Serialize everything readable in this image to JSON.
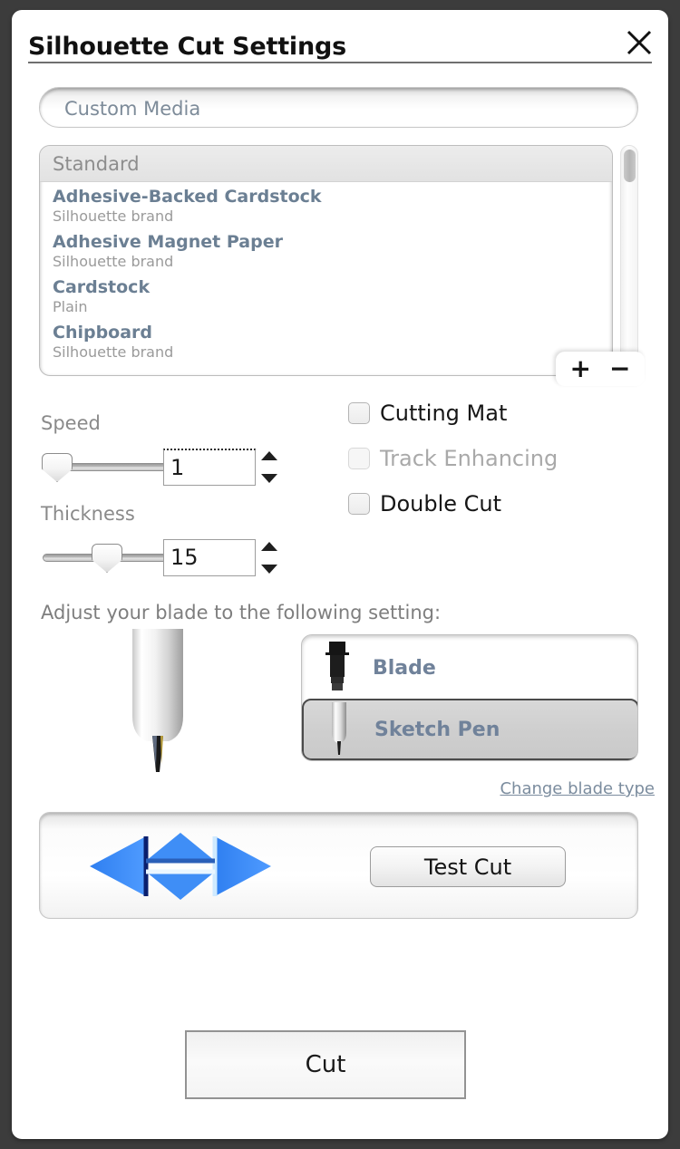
{
  "window": {
    "title": "Silhouette Cut Settings",
    "close_icon": "close-icon"
  },
  "custom_media": {
    "value": "Custom Media",
    "placeholder": "Custom Media"
  },
  "media_list": {
    "group_header": "Standard",
    "items": [
      {
        "name": "Adhesive-Backed Cardstock",
        "sub": "Silhouette brand"
      },
      {
        "name": "Adhesive Magnet Paper",
        "sub": "Silhouette brand"
      },
      {
        "name": "Cardstock",
        "sub": "Plain"
      },
      {
        "name": "Chipboard",
        "sub": "Silhouette brand"
      }
    ],
    "add_label": "+",
    "remove_label": "−"
  },
  "speed": {
    "label": "Speed",
    "value": "1",
    "slider_percent": 0
  },
  "thickness": {
    "label": "Thickness",
    "value": "15",
    "slider_percent": 38
  },
  "options": [
    {
      "label": "Cutting Mat",
      "checked": false,
      "disabled": false
    },
    {
      "label": "Track Enhancing",
      "checked": false,
      "disabled": true
    },
    {
      "label": "Double Cut",
      "checked": false,
      "disabled": false
    }
  ],
  "blade": {
    "instruction": "Adjust your blade to the following setting:",
    "types": [
      {
        "label": "Blade",
        "selected": false,
        "icon": "blade-icon"
      },
      {
        "label": "Sketch Pen",
        "selected": true,
        "icon": "sketch-pen-icon"
      }
    ],
    "change_link": "Change blade type"
  },
  "test_cut": {
    "button_label": "Test Cut",
    "arrows_icon": "four-way-arrows-icon"
  },
  "cut_button": {
    "label": "Cut"
  },
  "colors": {
    "accent_blue": "#2a7dea",
    "slate_text": "#6b7f93",
    "window_border": "#3c3c3c"
  }
}
